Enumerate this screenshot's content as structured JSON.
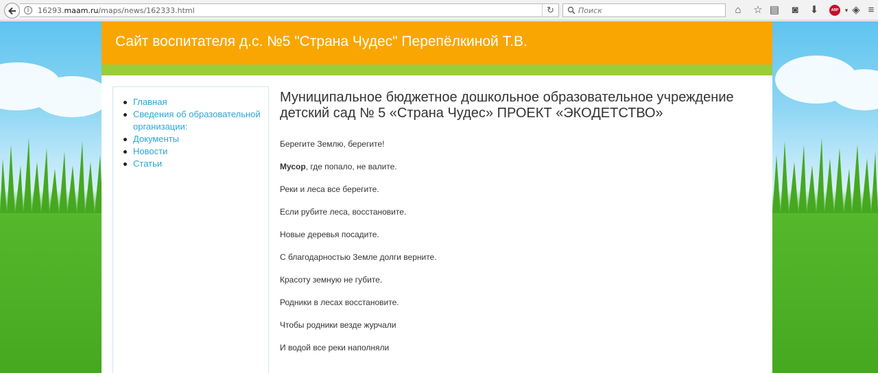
{
  "browser": {
    "url_prefix": "16293.",
    "url_domain": "maam.ru",
    "url_path": "/maps/news/162333.html",
    "search_placeholder": "Поиск",
    "abp_label": "ABP"
  },
  "site": {
    "title": "Сайт воспитателя д.с. №5 \"Страна Чудес\" Перепёлкиной Т.В."
  },
  "sidebar": {
    "items": [
      {
        "label": "Главная"
      },
      {
        "label": "Сведения об образовательной организации:"
      },
      {
        "label": "Документы"
      },
      {
        "label": "Новости"
      },
      {
        "label": "Статьи"
      }
    ]
  },
  "article": {
    "heading": "Муниципальное бюджетное дошкольное образовательное учреждение детский сад № 5 «Страна Чудес» ПРОЕКТ «ЭКОДЕТСТВО»",
    "lines": [
      {
        "text": "Берегите Землю, берегите!"
      },
      {
        "bold": "Мусор",
        "text": ", где попало, не валите."
      },
      {
        "text": "Реки и леса все берегите."
      },
      {
        "text": "Если рубите леса, восстановите."
      },
      {
        "text": "Новые деревья посадите."
      },
      {
        "text": "С благодарностью Земле долги верните."
      },
      {
        "text": "Красоту земную не губите."
      },
      {
        "text": "Родники в лесах восстановите."
      },
      {
        "text": "Чтобы родники везде журчали"
      },
      {
        "text": " И водой все реки наполняли"
      }
    ]
  }
}
